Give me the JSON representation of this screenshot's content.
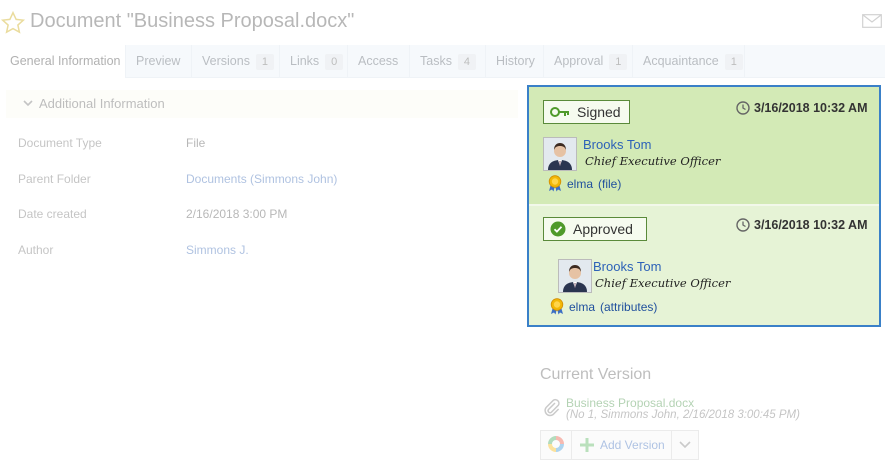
{
  "header": {
    "title": "Document \"Business Proposal.docx\"",
    "star_icon": "star-icon",
    "mail_icon": "mail-icon"
  },
  "tabs": [
    {
      "label": "General Information",
      "count": null,
      "active": true
    },
    {
      "label": "Preview",
      "count": null
    },
    {
      "label": "Versions",
      "count": "1"
    },
    {
      "label": "Links",
      "count": "0"
    },
    {
      "label": "Access",
      "count": null
    },
    {
      "label": "Tasks",
      "count": "4"
    },
    {
      "label": "History",
      "count": null
    },
    {
      "label": "Approval",
      "count": "1"
    },
    {
      "label": "Acquaintance",
      "count": "1"
    }
  ],
  "additional_info": {
    "title": "Additional Information",
    "properties": [
      {
        "label": "Document Type",
        "value": "File"
      },
      {
        "label": "Parent Folder",
        "value": "Documents (Simmons John)"
      },
      {
        "label": "Date created",
        "value": "2/16/2018 3:00 PM"
      },
      {
        "label": "Author",
        "value": "Simmons J."
      }
    ]
  },
  "signatures": [
    {
      "status": "Signed",
      "timestamp": "3/16/2018 10:32 AM",
      "person": "Brooks Tom",
      "role": "Chief Executive Officer",
      "cert_name": "elma",
      "cert_type": "(file)"
    },
    {
      "status": "Approved",
      "timestamp": "3/16/2018 10:32 AM",
      "person": "Brooks Tom",
      "role": "Chief Executive Officer",
      "cert_name": "elma",
      "cert_type": "(attributes)"
    }
  ],
  "current_version": {
    "title": "Current Version",
    "file_name": "Business Proposal.docx",
    "meta": "(No 1, Simmons John, 2/16/2018 3:00:45 PM)",
    "add_version_label": "Add Version"
  },
  "colors": {
    "accent_border": "#3a80c8",
    "signed_bg": "#d3eab6",
    "approved_bg": "#e6f3d6",
    "link": "#2d62b8"
  }
}
